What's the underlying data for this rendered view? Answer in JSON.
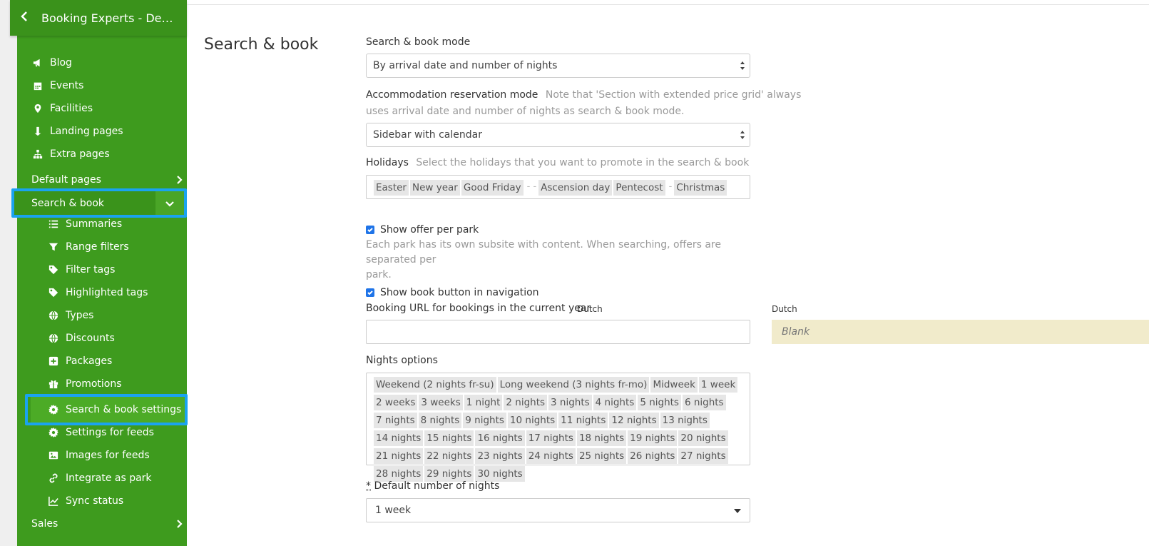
{
  "sidebar": {
    "header_title": "Booking Experts - Dem…",
    "items": [
      {
        "label": "Blog",
        "icon": "megaphone-icon"
      },
      {
        "label": "Events",
        "icon": "calendar-icon"
      },
      {
        "label": "Facilities",
        "icon": "map-marker-icon"
      },
      {
        "label": "Landing pages",
        "icon": "level-down-icon"
      },
      {
        "label": "Extra pages",
        "icon": "sitemap-icon"
      }
    ],
    "default_pages": "Default pages",
    "search_book": "Search & book",
    "sub_items": [
      {
        "label": "Summaries",
        "icon": "list-icon"
      },
      {
        "label": "Range filters",
        "icon": "filter-icon"
      },
      {
        "label": "Filter tags",
        "icon": "tag-icon"
      },
      {
        "label": "Highlighted tags",
        "icon": "tag-icon"
      },
      {
        "label": "Types",
        "icon": "globe-icon"
      },
      {
        "label": "Discounts",
        "icon": "globe-icon"
      },
      {
        "label": "Packages",
        "icon": "plus-square-icon"
      },
      {
        "label": "Promotions",
        "icon": "gift-icon"
      },
      {
        "label": "Search & book settings",
        "icon": "gear-icon"
      },
      {
        "label": "Settings for feeds",
        "icon": "gear-icon"
      },
      {
        "label": "Images for feeds",
        "icon": "image-icon"
      },
      {
        "label": "Integrate as park",
        "icon": "link-icon"
      },
      {
        "label": "Sync status",
        "icon": "line-chart-icon"
      }
    ],
    "sales": "Sales"
  },
  "main": {
    "section_title": "Search & book",
    "search_mode": {
      "label": "Search & book mode",
      "value": "By arrival date and number of nights"
    },
    "reservation_mode": {
      "label": "Accommodation reservation mode",
      "note_1": "Note that 'Section with extended price grid' always",
      "note_2": "uses arrival date and number of nights as search & book mode.",
      "value": "Sidebar with calendar"
    },
    "holidays": {
      "label": "Holidays",
      "note": "Select the holidays that you want to promote in the search & book",
      "tags": [
        "Easter",
        "New year",
        "Good Friday",
        "- -",
        "Ascension day",
        "Pentecost",
        "-",
        "Christmas"
      ]
    },
    "show_offer": {
      "label": "Show offer per park",
      "note_1": "Each park has its own subsite with content. When searching, offers are separated per",
      "note_2": "park.",
      "checked": true
    },
    "show_book_button": {
      "label": "Show book button in navigation",
      "checked": true
    },
    "booking_url": {
      "label": "Booking URL for bookings in the current year",
      "lang": "Dutch",
      "value": "",
      "right_lang": "Dutch",
      "right_value": "Blank"
    },
    "nights_options": {
      "label": "Nights options",
      "tags": [
        "Weekend (2 nights fr-su)",
        "Long weekend (3 nights fr-mo)",
        "Midweek",
        "1 week",
        "2 weeks",
        "3 weeks",
        "1 night",
        "2 nights",
        "3 nights",
        "4 nights",
        "5 nights",
        "6 nights",
        "7 nights",
        "8 nights",
        "9 nights",
        "10 nights",
        "11 nights",
        "12 nights",
        "13 nights",
        "14 nights",
        "15 nights",
        "16 nights",
        "17 nights",
        "18 nights",
        "19 nights",
        "20 nights",
        "21 nights",
        "22 nights",
        "23 nights",
        "24 nights",
        "25 nights",
        "26 nights",
        "27 nights",
        "28 nights",
        "29 nights",
        "30 nights"
      ]
    },
    "default_nights": {
      "required_mark": "*",
      "label": "Default number of nights",
      "value": "1 week"
    }
  }
}
